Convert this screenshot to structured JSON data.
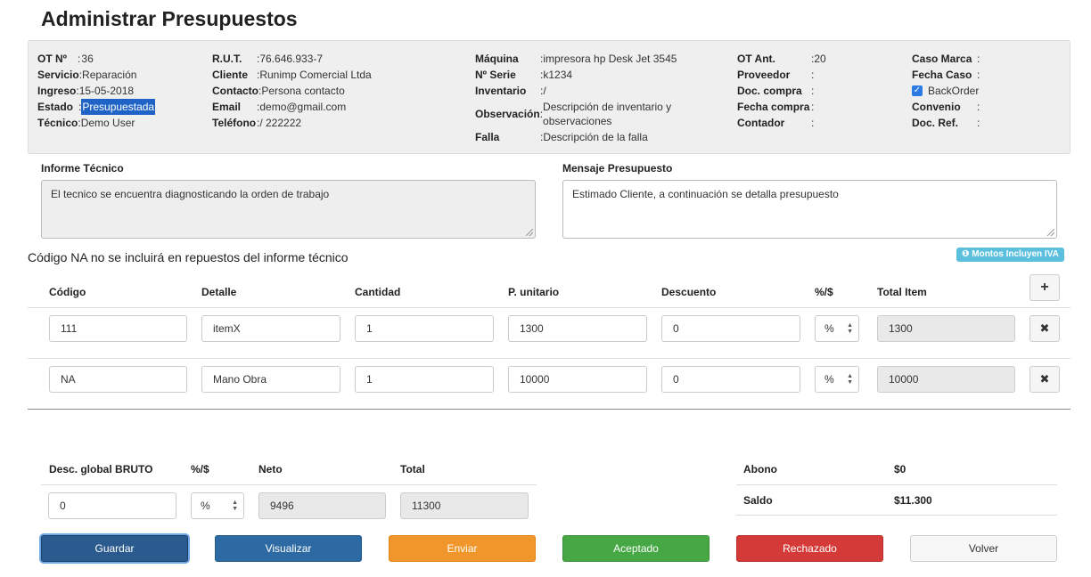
{
  "title": "Administrar Presupuestos",
  "info": {
    "col1": [
      {
        "label": "OT Nº",
        "value": "36"
      },
      {
        "label": "Servicio",
        "value": "Reparación"
      },
      {
        "label": "Ingreso",
        "value": "15-05-2018"
      },
      {
        "label": "Estado",
        "value": "Presupuestada"
      },
      {
        "label": "Técnico",
        "value": "Demo User"
      }
    ],
    "col2": [
      {
        "label": "R.U.T.",
        "value": "76.646.933-7"
      },
      {
        "label": "Cliente",
        "value": "Runimp Comercial Ltda"
      },
      {
        "label": "Contacto",
        "value": "Persona contacto"
      },
      {
        "label": "Email",
        "value": "demo@gmail.com"
      },
      {
        "label": "Teléfono",
        "value": "/ 222222"
      }
    ],
    "col3": [
      {
        "label": "Máquina",
        "value": "impresora hp Desk Jet 3545"
      },
      {
        "label": "Nº Serie",
        "value": "k1234"
      },
      {
        "label": "Inventario",
        "value": "/"
      },
      {
        "label": "Observación",
        "value_line1": "Descripción de inventario y",
        "value_line2": "observaciones"
      },
      {
        "label": "Falla",
        "value": "Descripción de la falla"
      }
    ],
    "col4": [
      {
        "label": "OT Ant.",
        "value": "20"
      },
      {
        "label": "Proveedor",
        "value": ""
      },
      {
        "label": "Doc. compra",
        "value": ""
      },
      {
        "label": "Fecha compra",
        "value": ""
      },
      {
        "label": "Contador",
        "value": ""
      }
    ],
    "col5": [
      {
        "label": "Caso Marca",
        "value": ""
      },
      {
        "label": "Fecha Caso",
        "value": ""
      },
      {
        "label": "BackOrder",
        "checked": true
      },
      {
        "label": "Convenio",
        "value": ""
      },
      {
        "label": "Doc. Ref.",
        "value": ""
      }
    ]
  },
  "informe": {
    "label": "Informe Técnico",
    "text": "El tecnico se encuentra diagnosticando la orden de trabajo"
  },
  "mensaje": {
    "label": "Mensaje Presupuesto",
    "text": "Estimado Cliente, a continuación se detalla presupuesto"
  },
  "note": "Código NA no se incluirá en repuestos del informe técnico",
  "badge": "Montos Incluyen IVA",
  "table": {
    "headers": [
      "Código",
      "Detalle",
      "Cantidad",
      "P. unitario",
      "Descuento",
      "%/$",
      "Total Item"
    ],
    "add_icon": "+",
    "remove_icon": "✖",
    "rows": [
      {
        "codigo": "111",
        "detalle": "itemX",
        "cantidad": "1",
        "precio": "1300",
        "descuento": "0",
        "tipo": "%",
        "total": "1300"
      },
      {
        "codigo": "NA",
        "detalle": "Mano Obra",
        "cantidad": "1",
        "precio": "10000",
        "descuento": "0",
        "tipo": "%",
        "total": "10000"
      }
    ]
  },
  "totals": {
    "headers": [
      "Desc. global BRUTO",
      "%/$",
      "Neto",
      "Total"
    ],
    "desc": "0",
    "tipo": "%",
    "neto": "9496",
    "total": "11300",
    "abono_label": "Abono",
    "abono": "$0",
    "saldo_label": "Saldo",
    "saldo": "$11.300"
  },
  "buttons": {
    "guardar": "Guardar",
    "visualizar": "Visualizar",
    "enviar": "Enviar",
    "aceptado": "Aceptado",
    "rechazado": "Rechazado",
    "volver": "Volver"
  }
}
